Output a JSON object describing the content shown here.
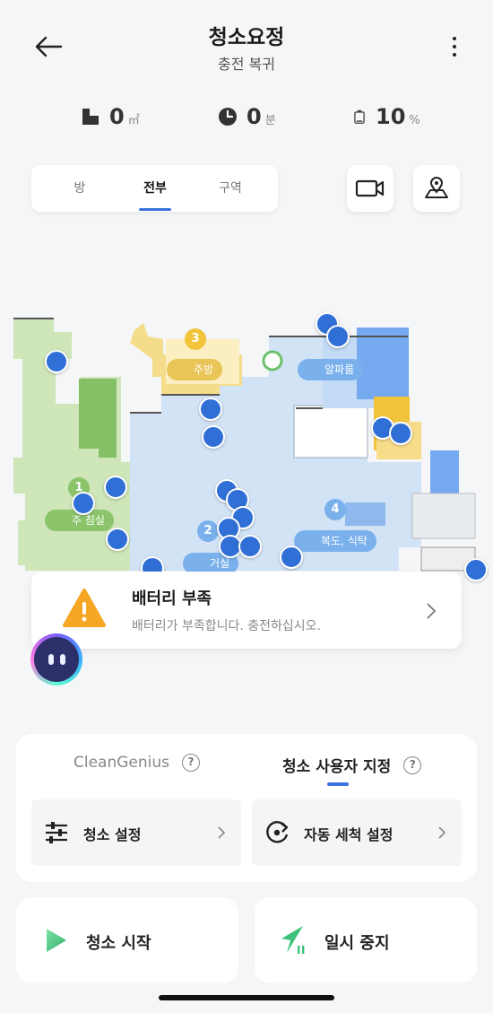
{
  "header": {
    "title": "청소요정",
    "subtitle": "충전 복귀"
  },
  "stats": {
    "area": {
      "value": "0",
      "unit": "㎡",
      "icon": "area-icon"
    },
    "time": {
      "value": "0",
      "unit": "분",
      "icon": "clock-icon"
    },
    "battery": {
      "value": "10",
      "unit": "%",
      "icon": "battery-icon"
    }
  },
  "tabs": [
    {
      "label": "방"
    },
    {
      "label": "전부",
      "active": true
    },
    {
      "label": "구역"
    }
  ],
  "map": {
    "rooms": [
      {
        "number": "1",
        "name": "주 침실",
        "color": "#8bc46b"
      },
      {
        "number": "2",
        "name": "거실",
        "color": "#7ab1ec"
      },
      {
        "number": "3",
        "name": "주방",
        "color": "#f2c43b"
      },
      {
        "number": "4",
        "name": "복도, 식탁",
        "color": "#7ab1ec"
      },
      {
        "number": "",
        "name": "알파룸",
        "color": "#7ab1ec"
      }
    ]
  },
  "alert": {
    "title": "배터리 부족",
    "message": "배터리가 부족합니다. 충전하십시오."
  },
  "modes": {
    "clean_genius": "CleanGenius",
    "custom": "청소 사용자 지정",
    "help_glyph": "?"
  },
  "options": {
    "clean_settings": "청소 설정",
    "auto_wash_settings": "자동 세척 설정"
  },
  "actions": {
    "start": "청소 시작",
    "pause": "일시 중지"
  },
  "colors": {
    "accent": "#3b73e0",
    "green_room": "#8bc46b",
    "blue_room": "#7ab1ec",
    "yellow_room": "#f2c43b",
    "warning": "#f5a623"
  }
}
